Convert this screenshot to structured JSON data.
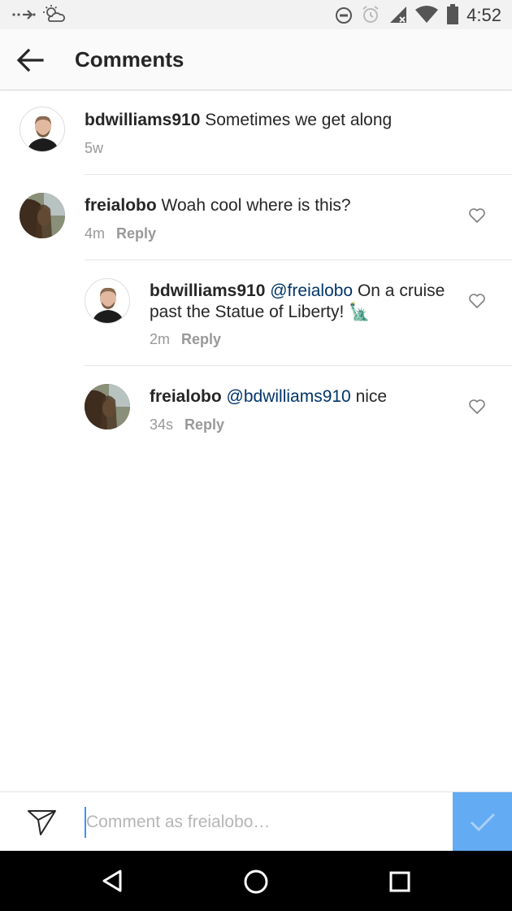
{
  "status_bar": {
    "time": "4:52",
    "icons": [
      "data-transfer-icon",
      "weather-icon",
      "do-not-disturb-icon",
      "alarm-icon",
      "signal-icon",
      "wifi-icon",
      "battery-icon"
    ]
  },
  "app_bar": {
    "title": "Comments",
    "back_icon": "arrow-left-icon"
  },
  "comments": [
    {
      "username": "bdwilliams910",
      "mention": "",
      "text": " Sometimes we get along",
      "time": "5w",
      "reply_label": "",
      "avatar": "avatar-bdwilliams910"
    },
    {
      "username": "freialobo",
      "mention": "",
      "text": " Woah cool where is this?",
      "time": "4m",
      "reply_label": "Reply",
      "avatar": "avatar-freialobo"
    },
    {
      "username": "bdwilliams910",
      "mention": " @freialobo",
      "text": " On a cruise past the Statue of Liberty! 🗽",
      "time": "2m",
      "reply_label": "Reply",
      "avatar": "avatar-bdwilliams910"
    },
    {
      "username": "freialobo",
      "mention": " @bdwilliams910",
      "text": " nice",
      "time": "34s",
      "reply_label": "Reply",
      "avatar": "avatar-freialobo"
    }
  ],
  "input_bar": {
    "placeholder": "Comment as freialobo…",
    "value": ""
  },
  "colors": {
    "accent": "#3897f0",
    "post_button": "#63abf3",
    "mention": "#003569",
    "meta": "#999999"
  },
  "nav_bar": {
    "icons": [
      "back-triangle-icon",
      "home-circle-icon",
      "recents-square-icon"
    ]
  }
}
